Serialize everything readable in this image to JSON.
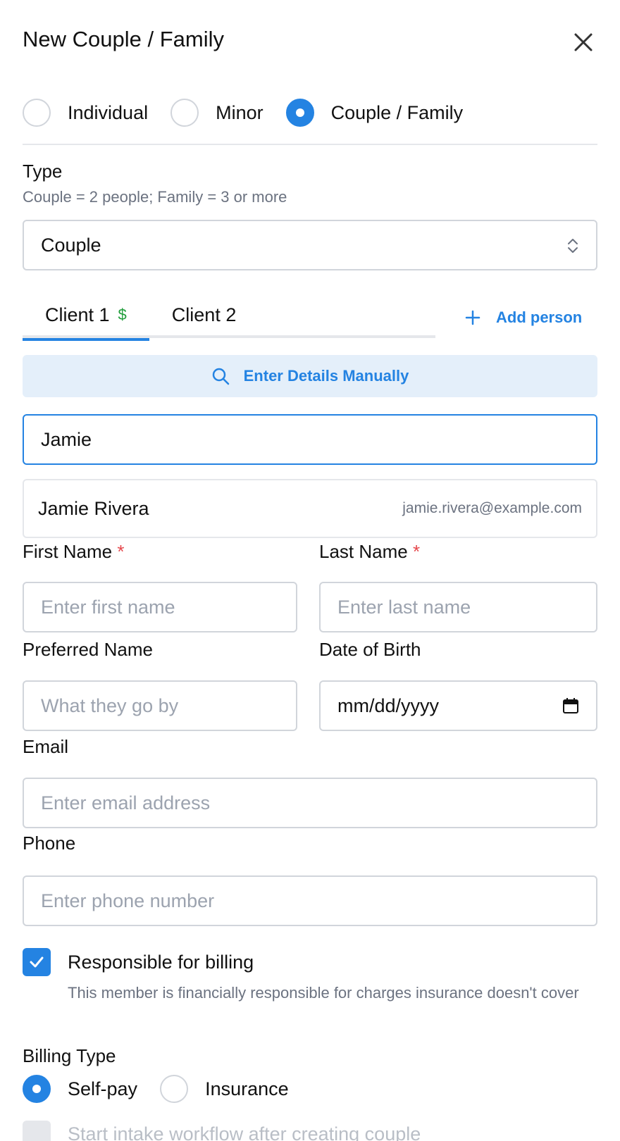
{
  "header": {
    "title": "New Couple / Family"
  },
  "client_kind": {
    "options": [
      "Individual",
      "Minor",
      "Couple / Family"
    ],
    "selected": "Couple / Family"
  },
  "type": {
    "label": "Type",
    "hint": "Couple = 2 people; Family = 3 or more",
    "value": "Couple"
  },
  "tabs": [
    {
      "label": "Client 1",
      "badge": "$",
      "active": true
    },
    {
      "label": "Client 2",
      "active": false
    }
  ],
  "add_person_label": "Add person",
  "manual_button_label": "Enter Details Manually",
  "search": {
    "value": "Jamie"
  },
  "suggestion": {
    "name": "Jamie Rivera",
    "email": "jamie.rivera@example.com"
  },
  "fields": {
    "first_name": {
      "label": "First Name",
      "required_mark": "*",
      "placeholder": "Enter first name"
    },
    "last_name": {
      "label": "Last Name",
      "required_mark": "*",
      "placeholder": "Enter last name"
    },
    "preferred_name": {
      "label": "Preferred Name",
      "placeholder": "What they go by"
    },
    "dob": {
      "label": "Date of Birth",
      "placeholder": "mm/dd/yyyy"
    },
    "email": {
      "label": "Email",
      "placeholder": "Enter email address"
    },
    "phone": {
      "label": "Phone",
      "placeholder": "Enter phone number"
    }
  },
  "billing_responsible": {
    "label": "Responsible for billing",
    "description": "This member is financially responsible for charges insurance doesn't cover",
    "checked": true
  },
  "billing_type": {
    "label": "Billing Type",
    "options": [
      "Self-pay",
      "Insurance"
    ],
    "selected": "Self-pay"
  },
  "intake": {
    "label": "Start intake workflow after creating couple",
    "checked": false
  },
  "colors": {
    "accent": "#2483e2",
    "required": "#e5484d",
    "billing_badge": "#1f9d3a",
    "manual_button_bg": "#e4effa"
  }
}
